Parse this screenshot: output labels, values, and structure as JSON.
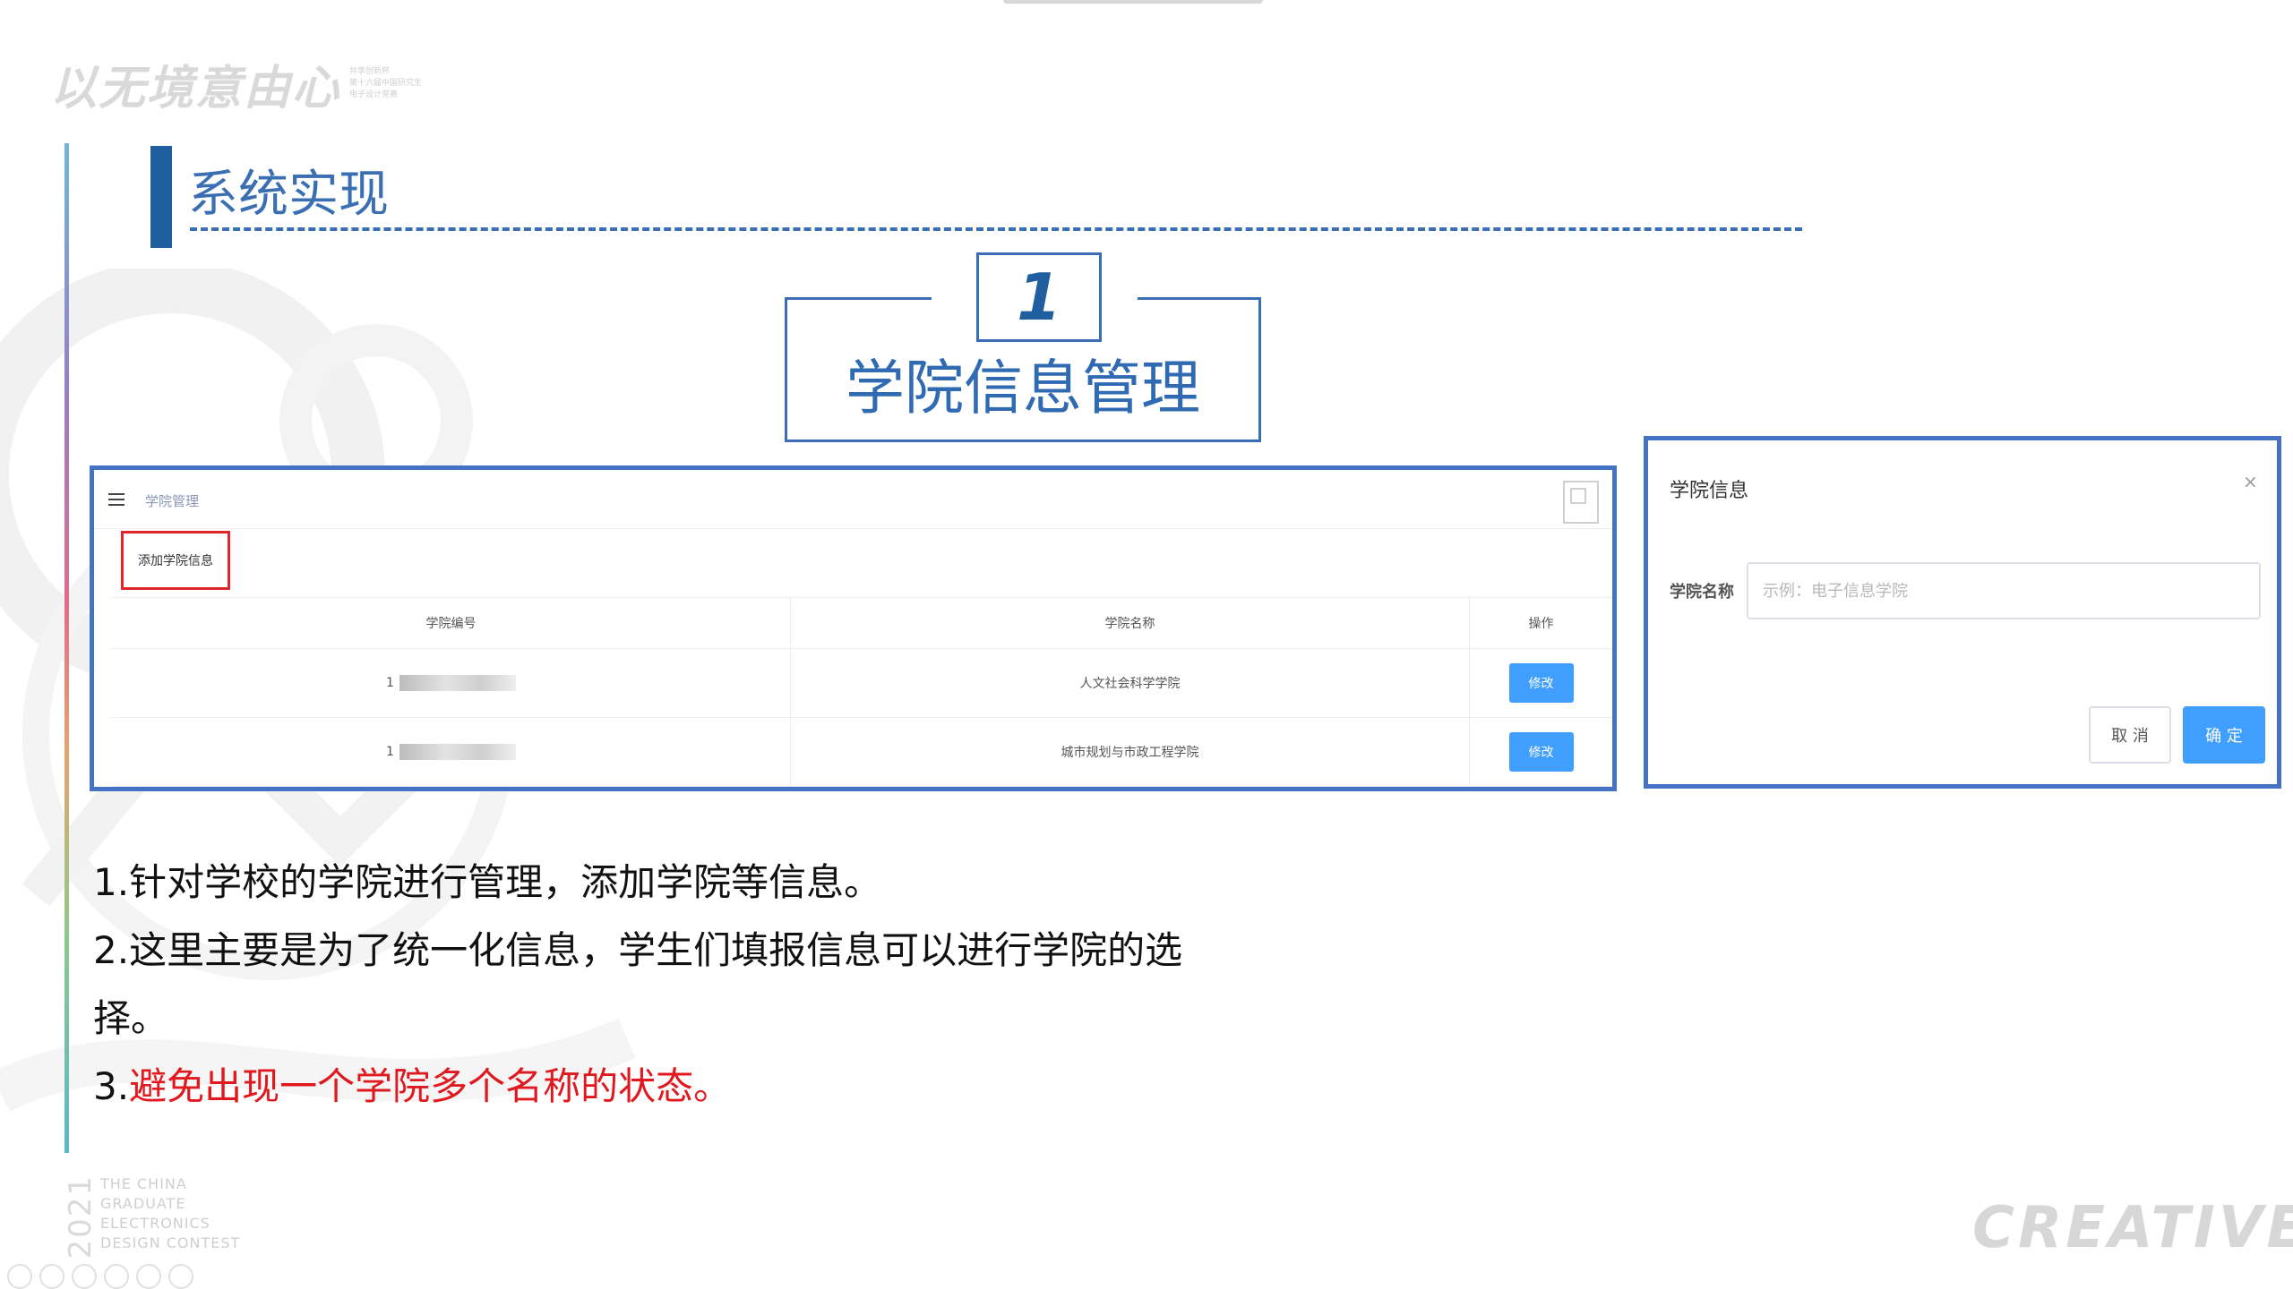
{
  "logo": {
    "main": "以无境意由心",
    "sub_lines": [
      "共享创新杯",
      "第十六届中国研究生",
      "电子设计竞赛"
    ]
  },
  "section": {
    "title": "系统实现"
  },
  "feature": {
    "number": "1",
    "title": "学院信息管理"
  },
  "panel_list": {
    "breadcrumb": "学院管理",
    "add_button": "添加学院信息",
    "columns": [
      "学院编号",
      "学院名称",
      "操作"
    ],
    "rows": [
      {
        "id_prefix": "1",
        "name": "人文社会科学学院",
        "action": "修改"
      },
      {
        "id_prefix": "1",
        "name": "城市规划与市政工程学院",
        "action": "修改"
      }
    ]
  },
  "panel_dialog": {
    "title": "学院信息",
    "close": "×",
    "field_label": "学院名称",
    "field_placeholder": "示例：电子信息学院",
    "field_value": "",
    "cancel": "取 消",
    "confirm": "确 定"
  },
  "description": {
    "line1": "1.针对学校的学院进行管理，添加学院等信息。",
    "line2": "2.这里主要是为了统一化信息，学生们填报信息可以进行学院的选择。",
    "line3_prefix": "3.",
    "line3_highlight": "避免出现一个学院多个名称的状态。"
  },
  "footer": {
    "year": "2021",
    "contest_lines": [
      "THE CHINA",
      "GRADUATE",
      "ELECTRONICS",
      "DESIGN CONTEST"
    ],
    "creative": "CREATIVE"
  },
  "colors": {
    "accent_blue": "#3a6fb4",
    "primary_button": "#409eff",
    "highlight_red": "#e0191f",
    "frame_blue": "#4472c4"
  }
}
